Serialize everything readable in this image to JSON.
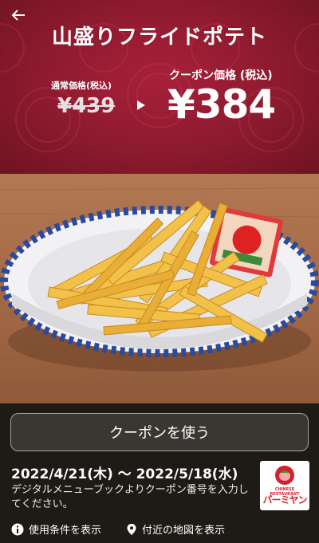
{
  "header": {
    "back_icon": "arrow-left-icon",
    "title": "山盛りフライドポテト",
    "regular_label": "通常価格(税込)",
    "regular_price": "¥439",
    "coupon_label": "クーポン価格 (税込)",
    "coupon_price": "¥384",
    "bg_color": "#8c1a2e"
  },
  "image": {
    "description_icon": "fries-plate-image"
  },
  "coupon": {
    "use_button": "クーポンを使う",
    "period": "2022/4/21(木) ～ 2022/5/18(水)",
    "description": "デジタルメニューブックよりクーポン番号を入力してください。"
  },
  "logo": {
    "small": "CHINESE RESTAURANT",
    "name": "バーミヤン"
  },
  "footer": {
    "terms_label": "使用条件を表示",
    "terms_icon": "info-icon",
    "map_label": "付近の地図を表示",
    "map_icon": "location-pin-icon"
  }
}
